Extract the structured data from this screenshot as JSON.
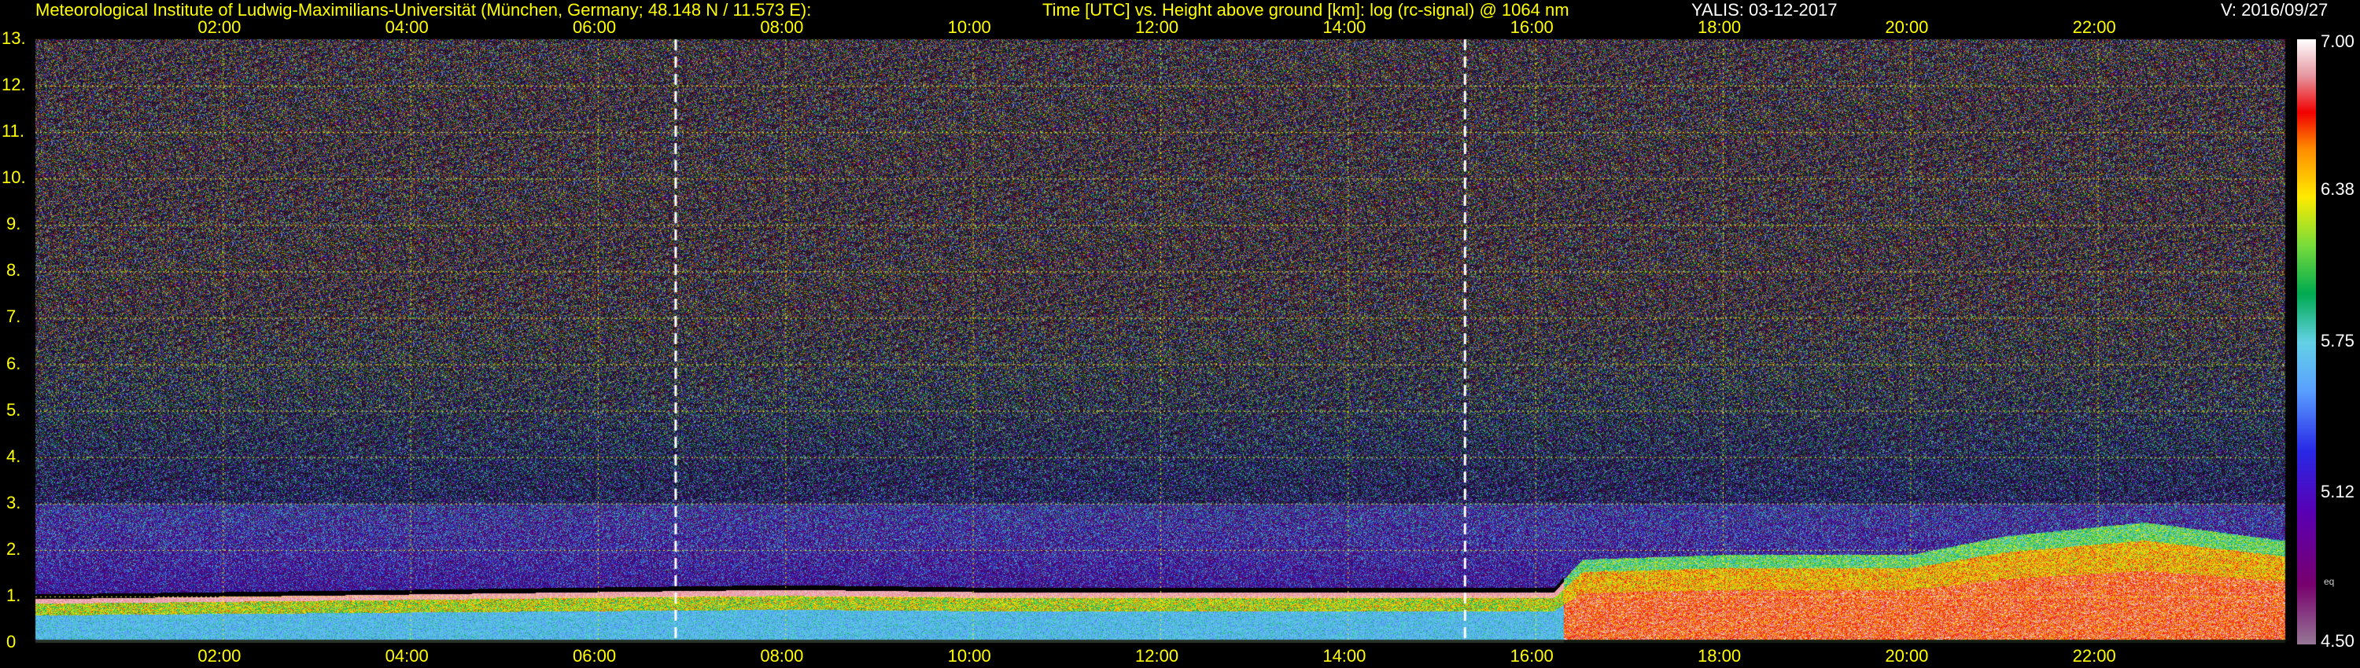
{
  "header": {
    "institute": "Meteorological Institute of Ludwig-Maximilians-Universität (München, Germany; 48.148 N / 11.573 E):",
    "plot_desc": "Time [UTC] vs. Height above ground [km]: log (rc-signal) @ 1064 nm",
    "instrument_date": "YALIS: 03-12-2017",
    "version": "V: 2016/09/27"
  },
  "colorbar": {
    "label_700": "7.00",
    "label_638": "6.38",
    "label_575": "5.75",
    "label_512": "5.12",
    "label_450": "4.50",
    "label_small": "eq"
  },
  "colors": {
    "grid": "#ffff00",
    "marker": "#ffffff",
    "text": "#ffff00"
  },
  "chart_data": {
    "type": "heatmap",
    "title": "Time [UTC] vs. Height above ground [km]: log (rc-signal) @ 1064 nm",
    "xlabel": "Time [UTC]",
    "ylabel": "Height above ground [km]",
    "x_ticks": [
      "02:00",
      "04:00",
      "06:00",
      "08:00",
      "10:00",
      "12:00",
      "14:00",
      "16:00",
      "18:00",
      "20:00",
      "22:00"
    ],
    "y_ticks": [
      "0",
      "1.",
      "2.",
      "3.",
      "4.",
      "5.",
      "6.",
      "7.",
      "8.",
      "9.",
      "10.",
      "11.",
      "12.",
      "13."
    ],
    "xlim_hours": [
      0,
      24
    ],
    "ylim_km": [
      0,
      13
    ],
    "color_scale": {
      "min": 4.5,
      "max": 7.0,
      "ticks": [
        4.5,
        5.12,
        5.75,
        6.38,
        7.0
      ]
    },
    "markers_hours": [
      6.83,
      15.25
    ],
    "boundary_layer_top_km": [
      {
        "t": 0.0,
        "h": 1.0
      },
      {
        "t": 2.0,
        "h": 1.05
      },
      {
        "t": 4.0,
        "h": 1.1
      },
      {
        "t": 6.0,
        "h": 1.15
      },
      {
        "t": 8.0,
        "h": 1.2
      },
      {
        "t": 10.0,
        "h": 1.15
      },
      {
        "t": 12.0,
        "h": 1.15
      },
      {
        "t": 14.0,
        "h": 1.15
      },
      {
        "t": 16.2,
        "h": 1.15
      },
      {
        "t": 16.5,
        "h": 1.8
      },
      {
        "t": 18.0,
        "h": 1.9
      },
      {
        "t": 20.0,
        "h": 1.9
      },
      {
        "t": 21.0,
        "h": 2.3
      },
      {
        "t": 22.5,
        "h": 2.6
      },
      {
        "t": 24.0,
        "h": 2.2
      }
    ]
  }
}
